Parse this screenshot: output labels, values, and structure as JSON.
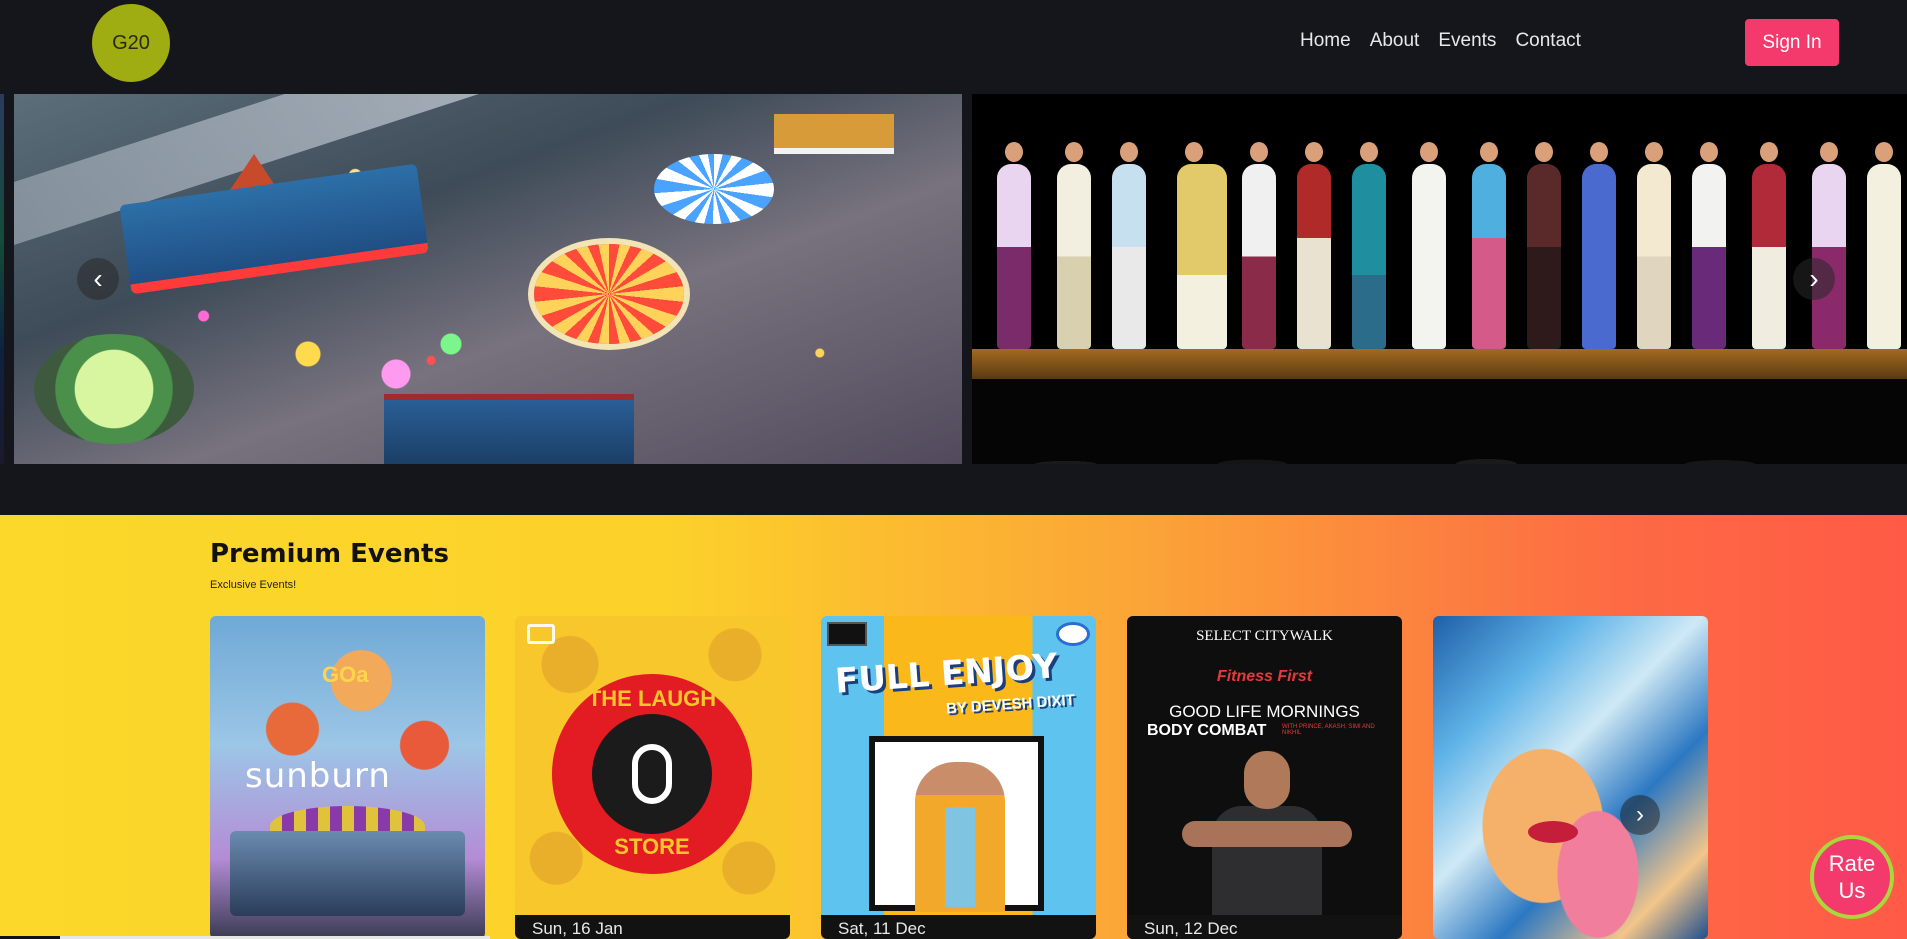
{
  "header": {
    "logo_text": "G20",
    "nav": [
      "Home",
      "About",
      "Events",
      "Contact"
    ],
    "signin_label": "Sign In"
  },
  "hero": {
    "prev_icon": "chevron-left-icon",
    "next_icon": "chevron-right-icon",
    "prev_glyph": "‹",
    "next_glyph": "›"
  },
  "premium": {
    "title": "Premium Events",
    "subtitle": "Exclusive Events!",
    "cards": [
      {
        "poster_text": "sunburn",
        "poster_sub": "GOa",
        "date": ""
      },
      {
        "poster_top": "THE LAUGH",
        "poster_bottom": "STORE",
        "date": "Sun, 16 Jan"
      },
      {
        "poster_title": "FULL ENJOY",
        "poster_sub": "BY DEVESH DIXIT",
        "date": "Sat, 11 Dec"
      },
      {
        "poster_brand": "SELECT CITYWALK",
        "poster_sponsor": "Fitness First",
        "poster_title": "GOOD LIFE MORNINGS",
        "poster_sub": "BODY COMBAT",
        "poster_fine": "WITH PRINCE, AKASH, SIMI AND NIKHIL",
        "date": "Sun, 12 Dec"
      },
      {
        "date": ""
      }
    ],
    "next_glyph": "›"
  },
  "rate": {
    "line1": "Rate",
    "line2": "Us"
  },
  "colors": {
    "background": "#15161b",
    "accent": "#f43a6c",
    "logo": "#9fad12",
    "premium_gradient_start": "#fbd82a",
    "premium_gradient_end": "#ff5a46"
  }
}
